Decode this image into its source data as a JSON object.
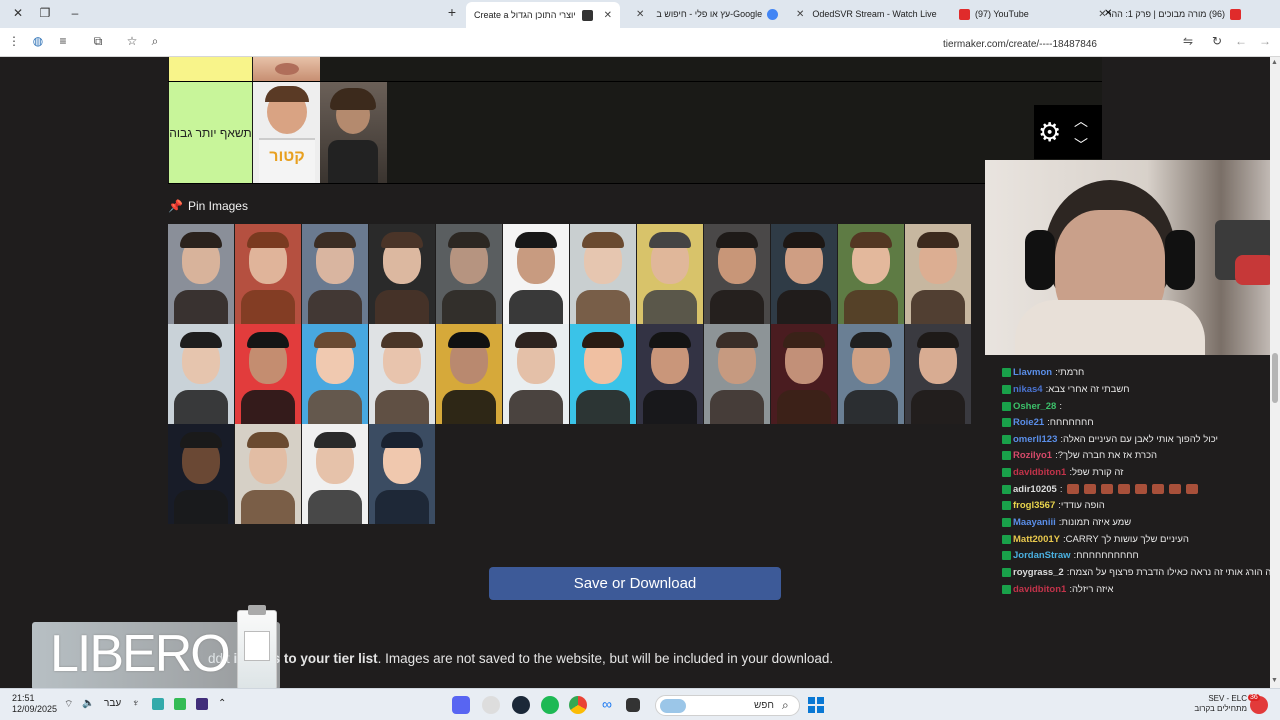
{
  "window": {
    "restore_glyph": "❐",
    "minimize_glyph": "–",
    "close_glyph": "✕",
    "new_tab_glyph": "+"
  },
  "tabs": [
    {
      "label": "(96) מורה מבוכים | פרק 1: ההר",
      "favicon_color": "#e02b2b"
    },
    {
      "label": "(97) YouTube",
      "favicon_color": "#e02b2b"
    },
    {
      "label": "OdedSVR Stream - Watch Live",
      "favicon_color": "#19a14a"
    },
    {
      "label": "עץ או פלי - חיפוש ב-Google",
      "favicon_color": "#4285f4"
    },
    {
      "label": "Create a דירוג יוצרי התוכן הגדול",
      "favicon_color": "#333333"
    }
  ],
  "toolbar": {
    "url": "tiermaker.com/create/----18487846"
  },
  "tiers": [
    {
      "label": "תשאף יותר גבוה",
      "color": "#c8f59a"
    }
  ],
  "pin_section": {
    "title": "Pin Images"
  },
  "save_button": {
    "label": "Save or Download"
  },
  "info": {
    "bold_part": "images to your tier list",
    "rest": ". Images are not saved to the website, but will be included in your download.",
    "partial_prefix": "ddit"
  },
  "overlay_logo": {
    "text": "LIBERO"
  },
  "chat": [
    {
      "user": "Llavmon",
      "msg": "חרמתי",
      "color": "#5a8ee8"
    },
    {
      "user": "nikas4",
      "msg": "חשבתי זה אחרי צבא",
      "color": "#4a73d1"
    },
    {
      "user": "Osher_28",
      "msg": "",
      "color": "#3cc06a"
    },
    {
      "user": "Roie21",
      "msg": "חחחחחחח",
      "color": "#5a8ee8"
    },
    {
      "user": "omerll123",
      "msg": "יכול להפוך אותי לאבן עם העיניים האלה",
      "color": "#5a8ee8"
    },
    {
      "user": "Rozilyo1",
      "msg": "הכרת אז את חברה שלך?",
      "color": "#d64a6a"
    },
    {
      "user": "davidbiton1",
      "msg": "זה קורת שפל",
      "color": "#c2334a"
    },
    {
      "user": "adir10205",
      "msg": "",
      "color": "#dcdcdc"
    },
    {
      "user": "frogl3567",
      "msg": "הופה עודדי",
      "color": "#e8d44d"
    },
    {
      "user": "Maayaniii",
      "msg": "שמע איזה תמונות",
      "color": "#5a8ee8"
    },
    {
      "user": "Matt2001Y",
      "msg": "העיניים שלך עושות לך CARRY",
      "color": "#e8c84d"
    },
    {
      "user": "JordanStraw",
      "msg": "חחחחחחחחחח",
      "color": "#4ab0e0"
    },
    {
      "user": "roygrass_2",
      "msg": "אתה הורג אותי זה נראה כאילו הדברת פרצוף על הצמח",
      "color": "#dcdcdc"
    },
    {
      "user": "davidbiton1",
      "msg": "איזה ריזלה",
      "color": "#c2334a"
    }
  ],
  "taskbar": {
    "time": "21:51",
    "date": "12/09/2025",
    "search_placeholder": "חפש",
    "lang": "עבר",
    "weather_title": "SEV - ELC",
    "weather_sub": "מתחילים בקרוב",
    "notif_count": "36"
  }
}
